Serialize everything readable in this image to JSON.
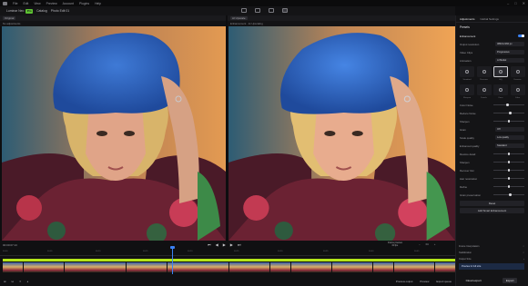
{
  "menubar": {
    "items": [
      "File",
      "Edit",
      "View",
      "Preview",
      "Account",
      "Plugins",
      "Help"
    ],
    "window_controls": [
      "–",
      "□",
      "✕"
    ]
  },
  "toolbar": {
    "app_label": "Luminar Neo",
    "badge": "Pro",
    "catalog_label": "Catalog",
    "file_name": "Photo Edit 01"
  },
  "views": {
    "left": {
      "tab": "Original",
      "sub": "No adjustments"
    },
    "right": {
      "tab": "AI Upscale",
      "sub": "Enhancement · 2x Upscaling"
    }
  },
  "sidebar": {
    "tabs": [
      "Adjustments",
      "Global Settings"
    ],
    "section_presets": "Presets",
    "section_enhancement": "Enhancement",
    "rows": [
      {
        "label": "Output resolution",
        "value": "3840×2160 px"
      },
      {
        "label": "Video Clips",
        "value": "Progressive"
      },
      {
        "label": "Animation",
        "value": "AI Model"
      }
    ],
    "grid_labels": [
      "Standard",
      "Preserve",
      "HQ",
      "Denoise",
      "Sharpen",
      "Details",
      "Face",
      "Color"
    ],
    "sliders": [
      {
        "label": "Color Noise",
        "value": 0.45
      },
      {
        "label": "Reduce Noise",
        "value": 0.55
      },
      {
        "label": "Sharpen",
        "value": 0.5
      }
    ],
    "dropdowns": [
      {
        "label": "Grain",
        "value": "Off"
      },
      {
        "label": "Scale quality",
        "value": "Low quality"
      },
      {
        "label": "Enhanced quality",
        "value": "Standard"
      }
    ],
    "sliders2": [
      {
        "label": "Restore detail",
        "value": 0.5
      },
      {
        "label": "Sharpen",
        "value": 0.5
      },
      {
        "label": "Recover blur",
        "value": 0.5
      },
      {
        "label": "Hair restoration",
        "value": 0.5
      },
      {
        "label": "Refine",
        "value": 0.5
      },
      {
        "label": "Grain preservation",
        "value": 0.55
      }
    ],
    "btn_reset": "Reset",
    "btn_add": "Add Smart Enhancement",
    "bottom_rows": [
      "Frame Interpolation",
      "Stabilization",
      "Output Size"
    ],
    "export_btn": "Export",
    "queue_btn": "Cloud export",
    "preview_btn": "Preview in full size"
  },
  "timeline": {
    "timecode": "00:00:07:13",
    "frame_preview_label": "Frame preview",
    "frame_preview_value": "60 fps",
    "zoom": "Fit",
    "ruler": [
      "00:00",
      "00:05",
      "00:10",
      "00:15",
      "00:20",
      "00:25",
      "00:30",
      "00:35",
      "00:40",
      "00:45"
    ],
    "progress": 0.38
  },
  "bottombar": {
    "left_icons": [
      "⊞",
      "⊟",
      "✕",
      "◂"
    ],
    "preview_output": "Preview output",
    "preview_label": "Preview",
    "export_queue": "Export queue"
  },
  "colors": {
    "accent_blue": "#3b82f6",
    "green_bar": "#b4e51a",
    "badge_green": "#5ec233"
  }
}
